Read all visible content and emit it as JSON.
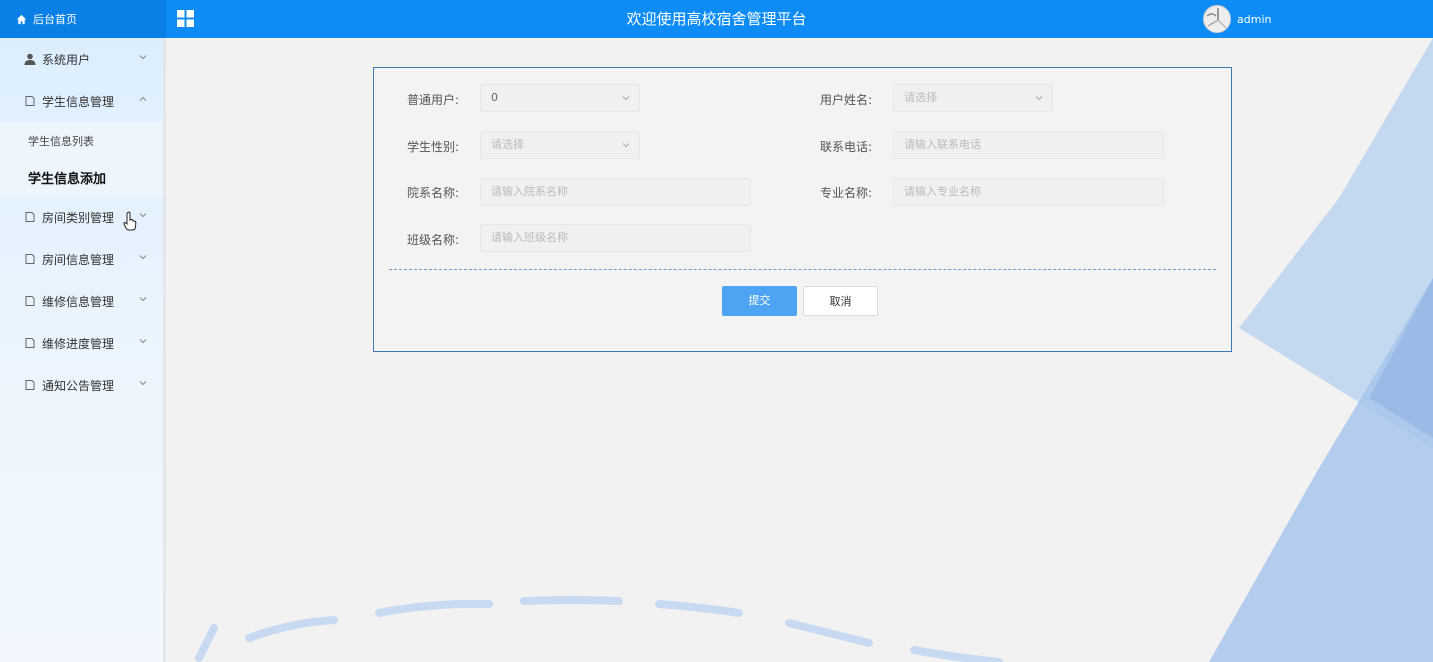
{
  "header": {
    "home_label": "后台首页",
    "title": "欢迎使用高校宿舍管理平台",
    "username": "admin"
  },
  "sidebar": {
    "items": [
      {
        "label": "系统用户",
        "expanded": false
      },
      {
        "label": "学生信息管理",
        "expanded": true,
        "children": [
          {
            "label": "学生信息列表",
            "active": false
          },
          {
            "label": "学生信息添加",
            "active": true
          }
        ]
      },
      {
        "label": "房间类别管理",
        "expanded": false
      },
      {
        "label": "房间信息管理",
        "expanded": false
      },
      {
        "label": "维修信息管理",
        "expanded": false
      },
      {
        "label": "维修进度管理",
        "expanded": false
      },
      {
        "label": "通知公告管理",
        "expanded": false
      }
    ]
  },
  "form": {
    "fields": {
      "user_type": {
        "label": "普通用户:",
        "value": "0"
      },
      "user_name": {
        "label": "用户姓名:",
        "placeholder": "请选择"
      },
      "gender": {
        "label": "学生性别:",
        "placeholder": "请选择"
      },
      "phone": {
        "label": "联系电话:",
        "placeholder": "请输入联系电话"
      },
      "college": {
        "label": "院系名称:",
        "placeholder": "请输入院系名称"
      },
      "major": {
        "label": "专业名称:",
        "placeholder": "请输入专业名称"
      },
      "class_name": {
        "label": "班级名称:",
        "placeholder": "请输入班级名称"
      }
    },
    "submit_label": "提交",
    "cancel_label": "取消"
  },
  "colors": {
    "header_bg": "#0d8cf6",
    "accent": "#4ea4f3",
    "card_border": "#3f78b5"
  },
  "icons": {
    "home": "home-icon",
    "grid": "grid-icon",
    "user": "user-icon",
    "menu": "document-icon",
    "chevron": "chevron-icon",
    "dropdown": "chevron-down-icon"
  }
}
